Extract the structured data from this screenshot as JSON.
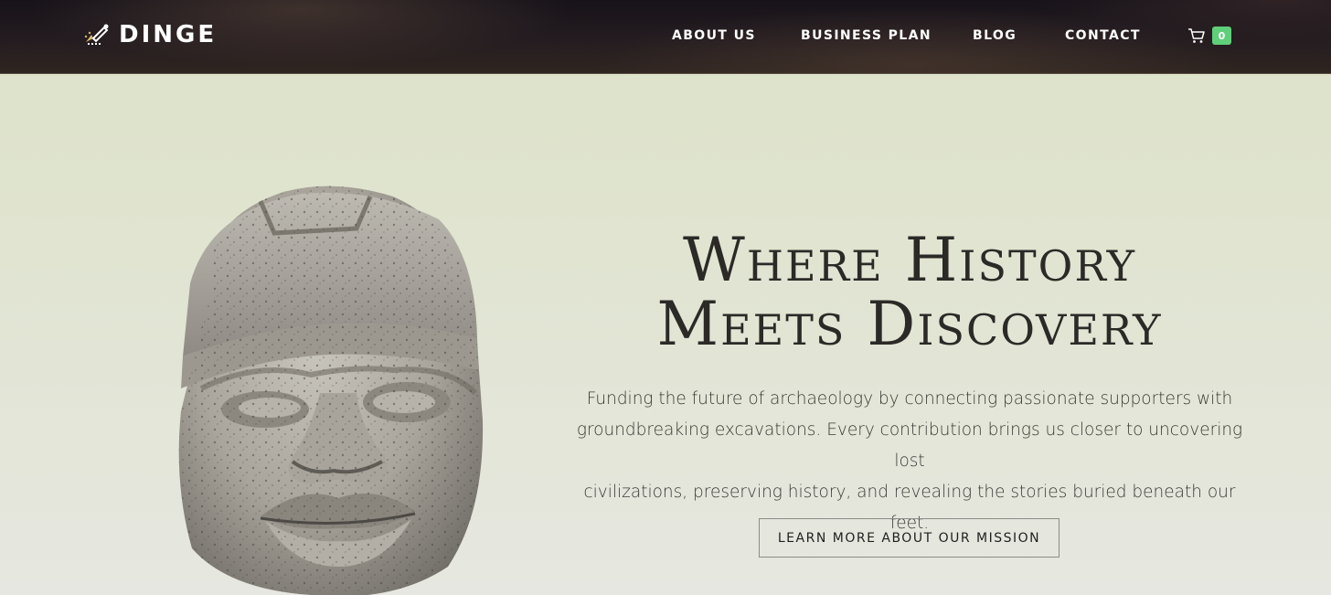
{
  "brand": {
    "name": "DINGE",
    "logo_icon": "trowel-brush-icon"
  },
  "nav": {
    "items": [
      {
        "label": "ABOUT US"
      },
      {
        "label": "BUSINESS PLAN"
      },
      {
        "label": "BLOG"
      },
      {
        "label": "CONTACT"
      }
    ],
    "cart": {
      "icon": "cart-icon",
      "count": "0",
      "badge_color": "#5fcf7a"
    }
  },
  "hero": {
    "title_line1": "Where History",
    "title_line2": "Meets Discovery",
    "description_line1": "Funding the future of archaeology by connecting passionate supporters with",
    "description_line2": "groundbreaking excavations. Every contribution brings us closer to uncovering lost",
    "description_line3": "civilizations, preserving history, and revealing the stories buried beneath our feet.",
    "cta_label": "LEARN MORE ABOUT OUR MISSION",
    "image": "olmec-colossal-head-image"
  },
  "colors": {
    "header_bg": "#1d171b",
    "page_bg": "#dde2c8",
    "text_dark": "#2b2a27",
    "accent_green": "#5fcf7a"
  }
}
